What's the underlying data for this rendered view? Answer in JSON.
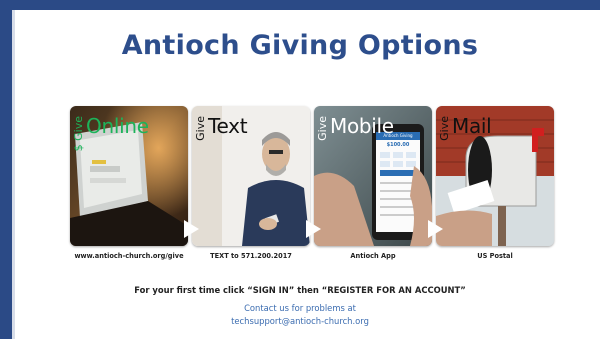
{
  "title": "Antioch Giving Options",
  "options": [
    {
      "give_label": "Give",
      "word": "Online",
      "word_color": "#1db35a",
      "give_symbol": "$",
      "caption": "www.antioch-church.org/give"
    },
    {
      "give_label": "Give",
      "word": "Text",
      "word_color": "#111111",
      "caption": "TEXT to 571.200.2017"
    },
    {
      "give_label": "Give",
      "word": "Mobile",
      "word_color": "#ffffff",
      "caption": "Antioch App",
      "phone": {
        "header": "Antioch Giving",
        "amount": "$100.00"
      }
    },
    {
      "give_label": "Give",
      "word": "Mail",
      "word_color": "#111111",
      "caption": "US Postal"
    }
  ],
  "instruction": "For your first time click “SIGN IN” then “REGISTER FOR AN ACCOUNT”",
  "contact_line1": "Contact us for problems at",
  "contact_line2": "techsupport@antioch-church.org",
  "colors": {
    "brand_blue": "#2d4e8c",
    "link_blue": "#3b6cb0",
    "frame": "#2b4a86"
  }
}
